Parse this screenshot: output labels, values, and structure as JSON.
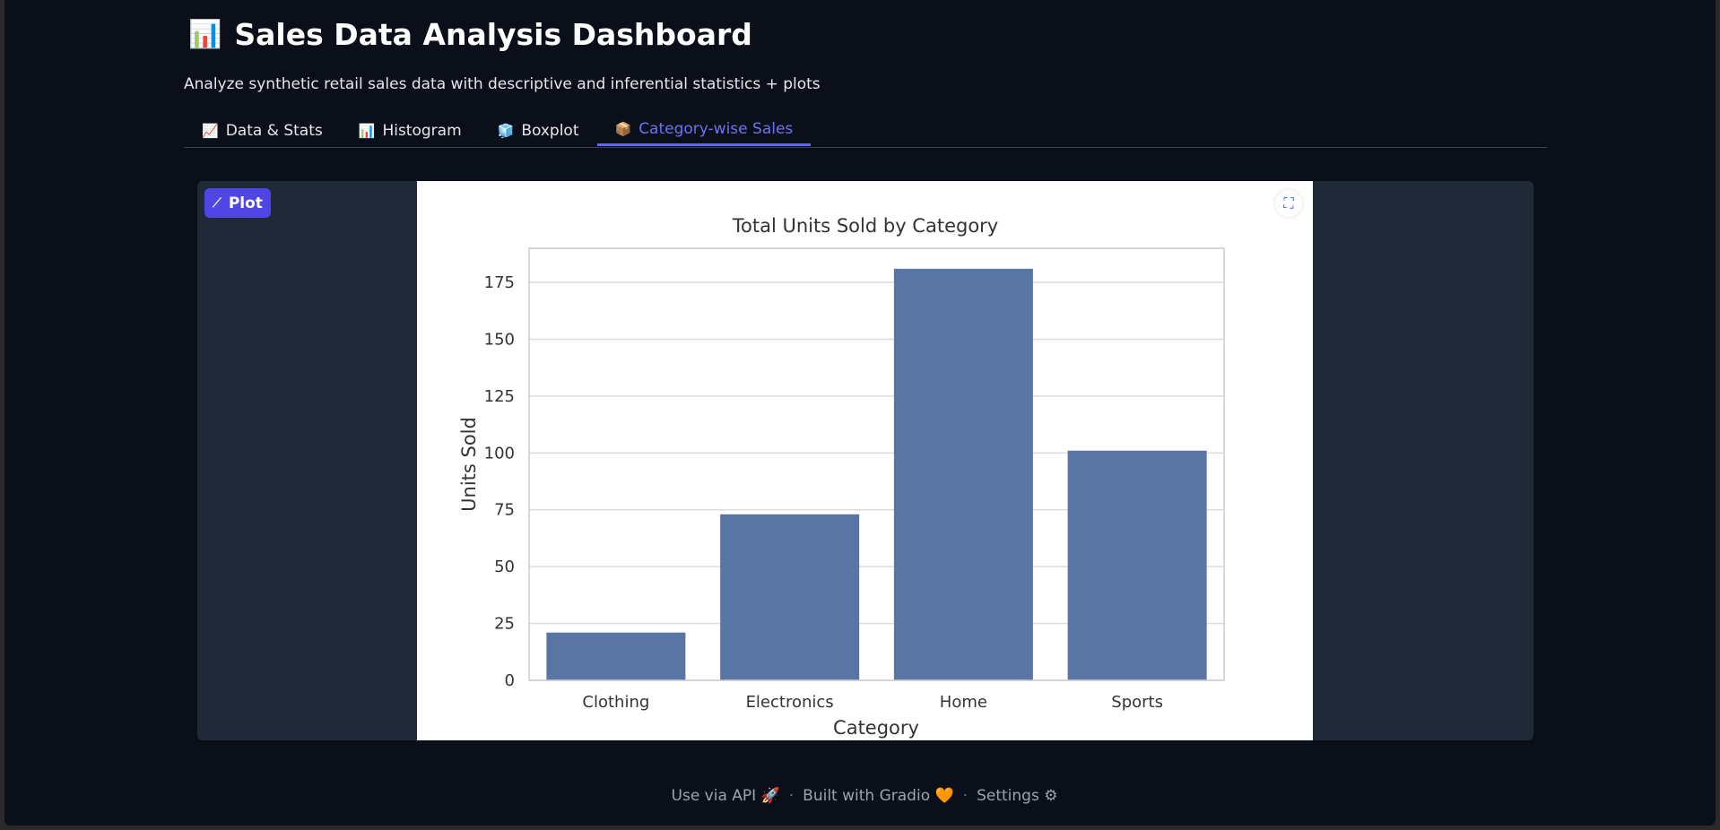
{
  "header": {
    "emoji": "📊",
    "title": "Sales Data Analysis Dashboard",
    "subtitle": "Analyze synthetic retail sales data with descriptive and inferential statistics + plots"
  },
  "tabs": [
    {
      "icon": "📈",
      "label": "Data & Stats"
    },
    {
      "icon": "📊",
      "label": "Histogram"
    },
    {
      "icon": "🧊",
      "label": "Boxplot"
    },
    {
      "icon": "📦",
      "label": "Category-wise Sales",
      "active": true
    }
  ],
  "plot_panel": {
    "badge_label": "Plot",
    "badge_icon": "chart-icon",
    "fullscreen_icon": "fullscreen-icon"
  },
  "chart_data": {
    "type": "bar",
    "title": "Total Units Sold by Category",
    "xlabel": "Category",
    "ylabel": "Units Sold",
    "categories": [
      "Clothing",
      "Electronics",
      "Home",
      "Sports"
    ],
    "values": [
      21,
      73,
      181,
      101
    ],
    "ylim": [
      0,
      190
    ],
    "yticks": [
      0,
      25,
      50,
      75,
      100,
      125,
      150,
      175
    ],
    "grid": true,
    "bar_color": "#5975a4"
  },
  "footer": {
    "api_label": "Use via API",
    "api_icon": "🚀",
    "built_label": "Built with Gradio",
    "built_icon": "🧡",
    "settings_label": "Settings",
    "settings_icon": "⚙",
    "separator": "·"
  }
}
